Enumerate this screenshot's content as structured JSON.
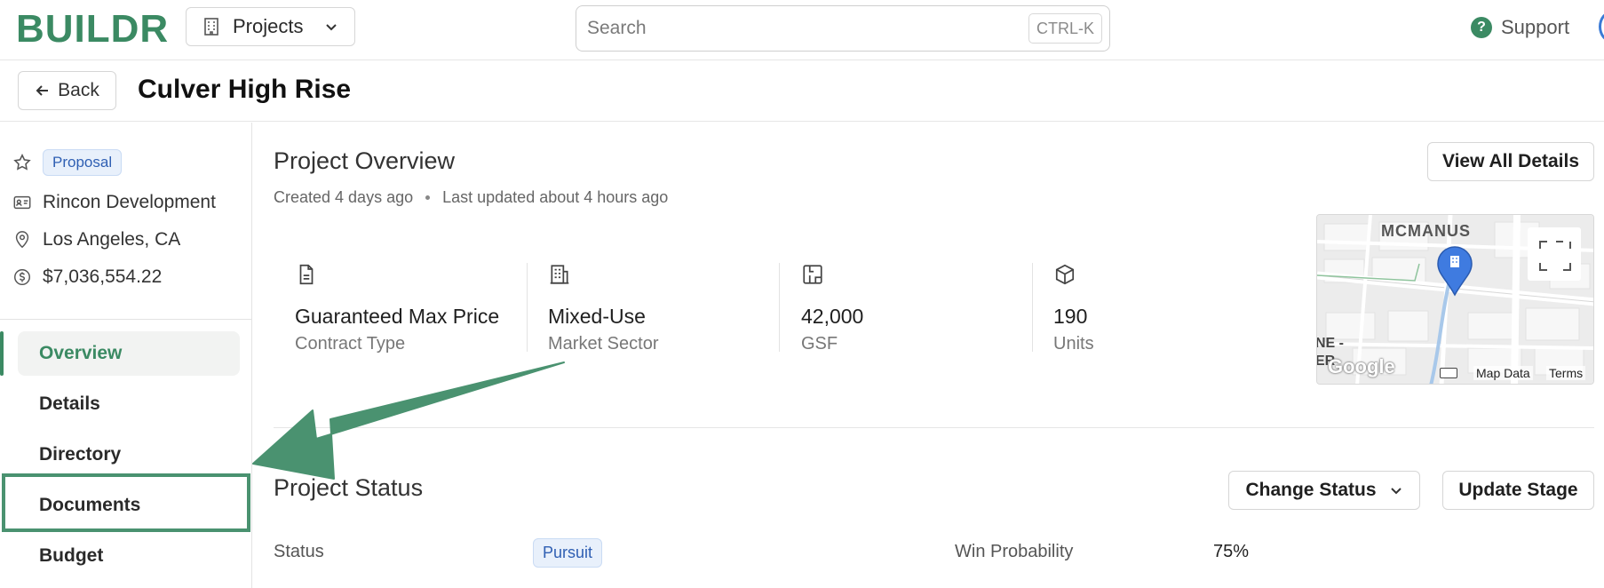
{
  "header": {
    "logo": "BUILDR",
    "projects_label": "Projects",
    "search_placeholder": "Search",
    "search_shortcut": "CTRL-K",
    "support_label": "Support"
  },
  "titlebar": {
    "back_label": "Back",
    "title": "Culver High Rise"
  },
  "sidebar": {
    "stage_badge": "Proposal",
    "company": "Rincon Development",
    "location": "Los Angeles, CA",
    "amount": "$7,036,554.22",
    "nav": [
      {
        "label": "Overview",
        "active": true
      },
      {
        "label": "Details"
      },
      {
        "label": "Directory"
      },
      {
        "label": "Documents"
      },
      {
        "label": "Budget"
      }
    ]
  },
  "overview": {
    "title": "Project Overview",
    "created": "Created 4 days ago",
    "updated": "Last updated about 4 hours ago",
    "view_all_label": "View All Details",
    "stats": [
      {
        "icon": "document-icon",
        "value": "Guaranteed Max Price",
        "label": "Contract Type"
      },
      {
        "icon": "building-icon",
        "value": "Mixed-Use",
        "label": "Market Sector"
      },
      {
        "icon": "floorplan-icon",
        "value": "42,000",
        "label": "GSF"
      },
      {
        "icon": "cube-icon",
        "value": "190",
        "label": "Units"
      }
    ],
    "map": {
      "area_label": "MCMANUS",
      "edge_label_top": "NE -",
      "edge_label_bottom": "ER",
      "google": "Google",
      "map_data": "Map Data",
      "terms": "Terms"
    }
  },
  "status": {
    "title": "Project Status",
    "change_status_label": "Change Status",
    "update_stage_label": "Update Stage",
    "status_label": "Status",
    "status_value": "Pursuit",
    "win_prob_label": "Win Probability",
    "win_prob_value": "75%"
  },
  "colors": {
    "brand": "#3b8a63",
    "badge_blue": "#2f5fb3",
    "annotation_green": "#4a9270"
  }
}
